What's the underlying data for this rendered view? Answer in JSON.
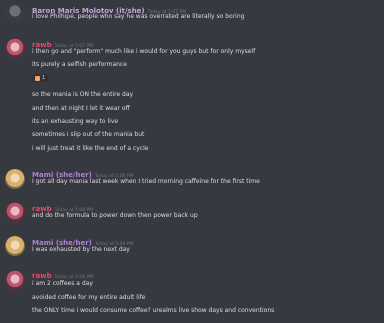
{
  "colors": {
    "background": "#36393f",
    "baron": "#c9a0dc",
    "rawb": "#e54a6b",
    "mami": "#b07fd8",
    "timestamp": "#72767d",
    "text": "#dcddde"
  },
  "messages": [
    {
      "author": "Baron Maris Molotov (it/she)",
      "timestamp": "Today at 5:07 PM",
      "avatar": "baron-avatar",
      "lines": [
        "i love Philhipé, people who say he was overrated are literally so boring"
      ]
    },
    {
      "author": "rawb",
      "timestamp": "Today at 5:07 PM",
      "avatar": "rawb-avatar",
      "lines": [
        "i then go and \"perform\" much like i would for you guys but for only myself",
        "its purely a selfish performance"
      ],
      "reaction": {
        "icon": "emoji-icon",
        "count": "1"
      },
      "lines_after": [
        "so the mania is ON the entire day",
        "and then at night I let it wear off",
        "its an exhausting way to live",
        "sometimes i slip out of the mania but",
        "i will just treat it like the end of a cycle"
      ]
    },
    {
      "author": "Mami (she/her)",
      "timestamp": "Today at 5:08 PM",
      "avatar": "mami-avatar",
      "lines": [
        "I got all day mania last week when I tried morning caffeine for the first time"
      ]
    },
    {
      "author": "rawb",
      "timestamp": "Today at 5:08 PM",
      "avatar": "rawb-avatar",
      "lines": [
        "and do the formula to power down then power back up"
      ]
    },
    {
      "author": "Mami (she/her)",
      "timestamp": "Today at 5:08 PM",
      "avatar": "mami-avatar",
      "lines": [
        "I was exhausted by the next day"
      ]
    },
    {
      "author": "rawb",
      "timestamp": "Today at 5:08 PM",
      "avatar": "rawb-avatar",
      "lines": [
        "i am 2 coffees a day",
        "avoided coffee for my entire adult life",
        "the ONLY time i would consume coffee? urealms live show days and conventions"
      ]
    }
  ]
}
